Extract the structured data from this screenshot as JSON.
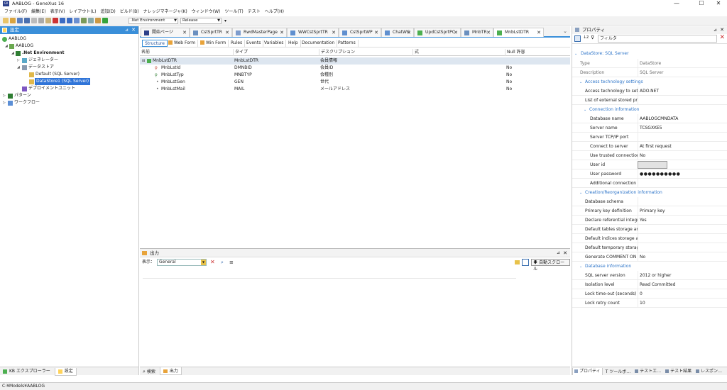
{
  "window": {
    "title": "AABLOG - GeneXus 16",
    "app_icon_text": "GX",
    "minimize": "—",
    "maximize": "☐",
    "close": "✕"
  },
  "menu": [
    "ファイル(F)",
    "編集(E)",
    "表示(V)",
    "レイアウト(L)",
    "追加(D)",
    "ビルド(B)",
    "ナレッジマネージャ(K)",
    "ウィンドウ(W)",
    "ツール(T)",
    "テスト",
    "ヘルプ(H)"
  ],
  "toolbar": {
    "environment": ".Net Environment",
    "configuration": "Release"
  },
  "left_panel": {
    "title": "設定",
    "tree": [
      {
        "label": "AABLOG",
        "level": 0
      },
      {
        "label": "AABLOG",
        "level": 1
      },
      {
        "label": ".Net Environment",
        "level": 2,
        "bold": true
      },
      {
        "label": "ジェネレーター",
        "level": 3
      },
      {
        "label": "データストア",
        "level": 3
      },
      {
        "label": "Default (SQL Server)",
        "level": 4
      },
      {
        "label": "DataStore1 (SQL Server)",
        "level": 4,
        "selected": true
      },
      {
        "label": "デプロイメントユニット",
        "level": 3
      },
      {
        "label": "パターン",
        "level": 1
      },
      {
        "label": "ワークフロー",
        "level": 1
      }
    ],
    "bottom_tabs": [
      "KB エクスプローラー",
      "設定"
    ]
  },
  "doc_tabs": [
    "開始ページ",
    "CstSprtTR",
    "RwdMasterPage",
    "WWCstSprtTR",
    "CstSprtWP",
    "ChatWC",
    "UpdCstSprtPC",
    "MnbTR",
    "MnbLstDTR"
  ],
  "sub_tabs": [
    "Structure",
    "Web Form",
    "Win Form",
    "Rules",
    "Events",
    "Variables",
    "Help",
    "Documentation",
    "Patterns"
  ],
  "grid": {
    "columns": [
      "名前",
      "タイプ",
      "デスクリプション",
      "式",
      "Null 許容"
    ],
    "rows": [
      {
        "name": "MnbLstDTR",
        "type": "MnbLstDTR",
        "desc": "会員情報",
        "expr": "",
        "nullable": ""
      },
      {
        "name": "MnbLstId",
        "type": "DMNBID",
        "desc": "会員ID",
        "expr": "",
        "nullable": "No"
      },
      {
        "name": "MnbLstTyp",
        "type": "MNBTYP",
        "desc": "会種別",
        "expr": "",
        "nullable": "No"
      },
      {
        "name": "MnbLstGen",
        "type": "GEN",
        "desc": "世代",
        "expr": "",
        "nullable": "No"
      },
      {
        "name": "MnbLstMail",
        "type": "MAIL",
        "desc": "メールアドレス",
        "expr": "",
        "nullable": "No"
      }
    ]
  },
  "output": {
    "title": "出力",
    "show_label": "表示：",
    "show_value": "General",
    "autoscroll": "自動スクロール",
    "bottom_tabs": [
      "検索",
      "出力"
    ]
  },
  "properties": {
    "title": "プロパティ",
    "filter_placeholder": "フィルタ",
    "header": "DataStore: SQL Server",
    "rows_top": [
      {
        "k": "Type",
        "v": "DataStore"
      },
      {
        "k": "Description",
        "v": "SQL Server"
      }
    ],
    "sec_access": "Access technology settings",
    "access_rows": [
      {
        "k": "Access technology to set",
        "v": "ADO.NET"
      },
      {
        "k": "List of external stored pro",
        "v": ""
      }
    ],
    "sec_conn": "Connection information",
    "conn_rows": [
      {
        "k": "Database name",
        "v": "AABLOGCMNDATA"
      },
      {
        "k": "Server name",
        "v": "TCSGXKE5"
      },
      {
        "k": "Server TCP/IP port",
        "v": ""
      },
      {
        "k": "Connect to server",
        "v": "At first request"
      },
      {
        "k": "Use trusted connection",
        "v": "No"
      },
      {
        "k": "User id",
        "v": ""
      },
      {
        "k": "User password",
        "v": "●●●●●●●●●●"
      },
      {
        "k": "Additional connection",
        "v": ""
      }
    ],
    "sec_create": "Creation/Reorganization information",
    "create_rows": [
      {
        "k": "Database schema",
        "v": ""
      },
      {
        "k": "Primary key definition",
        "v": "Primary key"
      },
      {
        "k": "Declare referential integr",
        "v": "Yes"
      },
      {
        "k": "Default tables storage an",
        "v": ""
      },
      {
        "k": "Default indices storage a",
        "v": ""
      },
      {
        "k": "Default temporary storag",
        "v": ""
      },
      {
        "k": "Generate COMMENT ON",
        "v": "No"
      }
    ],
    "sec_db": "Database information",
    "db_rows": [
      {
        "k": "SQL server version",
        "v": "2012 or higher"
      },
      {
        "k": "Isolation level",
        "v": "Read Committed"
      },
      {
        "k": "Lock time-out (seconds)",
        "v": "0"
      },
      {
        "k": "Lock retry count",
        "v": "10"
      }
    ],
    "bottom_tabs": [
      "プロパティ",
      "ツールボ…",
      "テストエ…",
      "テスト結果",
      "レスポン…"
    ]
  },
  "status": "C:¥Models¥AABLOG"
}
